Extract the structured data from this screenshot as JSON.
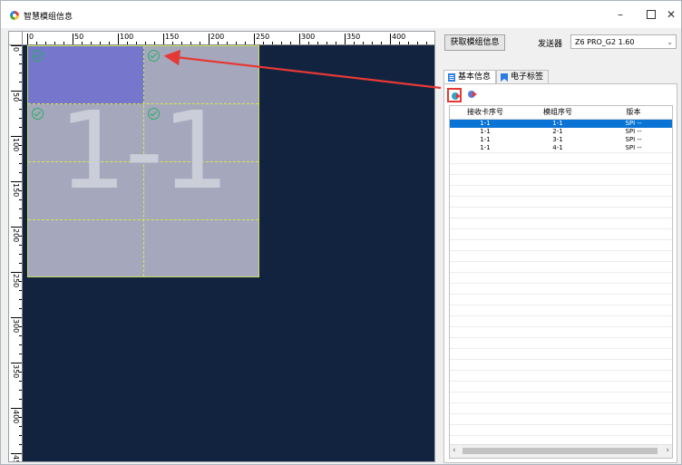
{
  "window": {
    "title": "智慧模组信息",
    "controls": {
      "minimize": "–",
      "close": "✕"
    }
  },
  "ruler": {
    "top_labels": [
      "0",
      "50",
      "100",
      "150",
      "200",
      "250",
      "300",
      "350",
      "400"
    ],
    "left_labels": [
      "0",
      "50",
      "100",
      "150",
      "200",
      "250",
      "300",
      "350",
      "400",
      "45"
    ]
  },
  "module": {
    "label": "1-1",
    "status_color": "#27ae60",
    "selected_color": "#7677cc"
  },
  "toolbar": {
    "get_info_label": "获取模组信息",
    "sender_label": "发送器",
    "sender_value": "Z6 PRO_G2 1.60"
  },
  "tabs": [
    {
      "label": "基本信息",
      "active": true,
      "icon": "document-icon"
    },
    {
      "label": "电子标签",
      "active": false,
      "icon": "bookmark-icon"
    }
  ],
  "grid": {
    "columns": [
      "接收卡序号",
      "模组序号",
      "版本"
    ],
    "rows": [
      {
        "card": "1-1",
        "module": "1-1",
        "version": "SPI --",
        "selected": true
      },
      {
        "card": "1-1",
        "module": "2-1",
        "version": "SPI --",
        "selected": false
      },
      {
        "card": "1-1",
        "module": "3-1",
        "version": "SPI --",
        "selected": false
      },
      {
        "card": "1-1",
        "module": "4-1",
        "version": "SPI --",
        "selected": false
      }
    ]
  },
  "colors": {
    "accent_red": "#e53935",
    "selection_blue": "#0a74d6",
    "canvas_bg": "#122340"
  }
}
